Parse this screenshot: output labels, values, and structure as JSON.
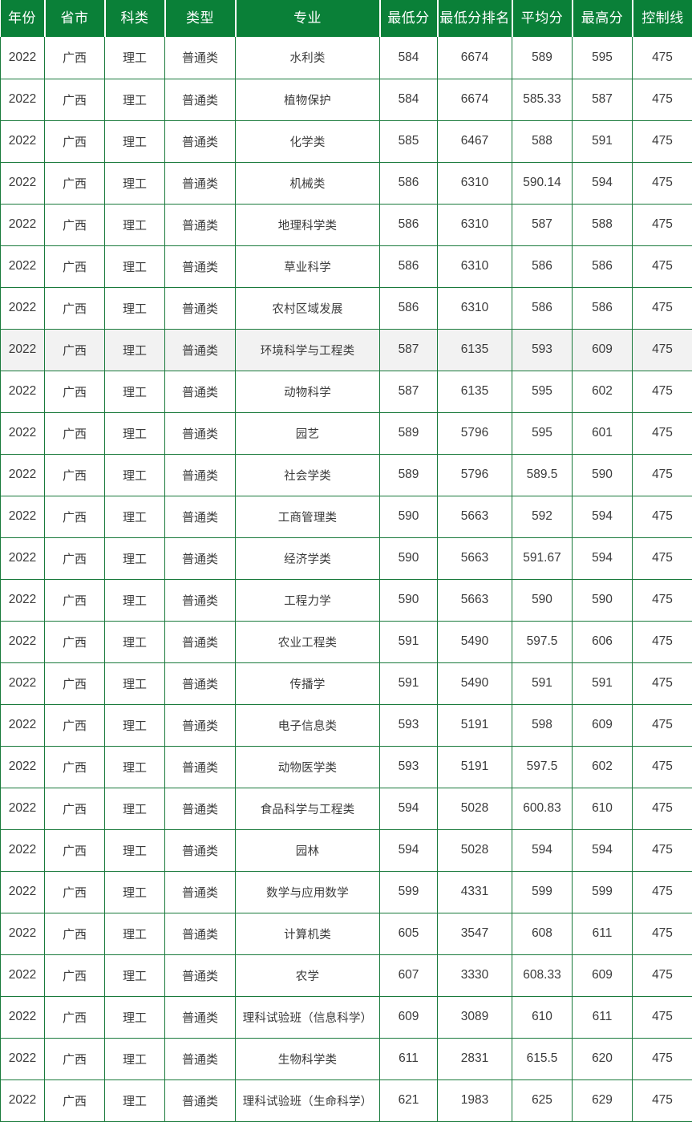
{
  "table": {
    "columns": [
      {
        "key": "year",
        "label": "年份"
      },
      {
        "key": "prov",
        "label": "省市"
      },
      {
        "key": "subj",
        "label": "科类"
      },
      {
        "key": "type",
        "label": "类型"
      },
      {
        "key": "major",
        "label": "专业"
      },
      {
        "key": "min",
        "label": "最低分"
      },
      {
        "key": "rank",
        "label": "最低分排名"
      },
      {
        "key": "avg",
        "label": "平均分"
      },
      {
        "key": "max",
        "label": "最高分"
      },
      {
        "key": "line",
        "label": "控制线"
      }
    ],
    "header_background": "#0a8038",
    "header_text_color": "#ffffff",
    "grid_color": "#1a7a3c",
    "highlight_background": "#f2f2f2",
    "highlighted_row_index": 7,
    "rows": [
      {
        "year": "2022",
        "prov": "广西",
        "subj": "理工",
        "type": "普通类",
        "major": "水利类",
        "min": "584",
        "rank": "6674",
        "avg": "589",
        "max": "595",
        "line": "475"
      },
      {
        "year": "2022",
        "prov": "广西",
        "subj": "理工",
        "type": "普通类",
        "major": "植物保护",
        "min": "584",
        "rank": "6674",
        "avg": "585.33",
        "max": "587",
        "line": "475"
      },
      {
        "year": "2022",
        "prov": "广西",
        "subj": "理工",
        "type": "普通类",
        "major": "化学类",
        "min": "585",
        "rank": "6467",
        "avg": "588",
        "max": "591",
        "line": "475"
      },
      {
        "year": "2022",
        "prov": "广西",
        "subj": "理工",
        "type": "普通类",
        "major": "机械类",
        "min": "586",
        "rank": "6310",
        "avg": "590.14",
        "max": "594",
        "line": "475"
      },
      {
        "year": "2022",
        "prov": "广西",
        "subj": "理工",
        "type": "普通类",
        "major": "地理科学类",
        "min": "586",
        "rank": "6310",
        "avg": "587",
        "max": "588",
        "line": "475"
      },
      {
        "year": "2022",
        "prov": "广西",
        "subj": "理工",
        "type": "普通类",
        "major": "草业科学",
        "min": "586",
        "rank": "6310",
        "avg": "586",
        "max": "586",
        "line": "475"
      },
      {
        "year": "2022",
        "prov": "广西",
        "subj": "理工",
        "type": "普通类",
        "major": "农村区域发展",
        "min": "586",
        "rank": "6310",
        "avg": "586",
        "max": "586",
        "line": "475"
      },
      {
        "year": "2022",
        "prov": "广西",
        "subj": "理工",
        "type": "普通类",
        "major": "环境科学与工程类",
        "min": "587",
        "rank": "6135",
        "avg": "593",
        "max": "609",
        "line": "475"
      },
      {
        "year": "2022",
        "prov": "广西",
        "subj": "理工",
        "type": "普通类",
        "major": "动物科学",
        "min": "587",
        "rank": "6135",
        "avg": "595",
        "max": "602",
        "line": "475"
      },
      {
        "year": "2022",
        "prov": "广西",
        "subj": "理工",
        "type": "普通类",
        "major": "园艺",
        "min": "589",
        "rank": "5796",
        "avg": "595",
        "max": "601",
        "line": "475"
      },
      {
        "year": "2022",
        "prov": "广西",
        "subj": "理工",
        "type": "普通类",
        "major": "社会学类",
        "min": "589",
        "rank": "5796",
        "avg": "589.5",
        "max": "590",
        "line": "475"
      },
      {
        "year": "2022",
        "prov": "广西",
        "subj": "理工",
        "type": "普通类",
        "major": "工商管理类",
        "min": "590",
        "rank": "5663",
        "avg": "592",
        "max": "594",
        "line": "475"
      },
      {
        "year": "2022",
        "prov": "广西",
        "subj": "理工",
        "type": "普通类",
        "major": "经济学类",
        "min": "590",
        "rank": "5663",
        "avg": "591.67",
        "max": "594",
        "line": "475"
      },
      {
        "year": "2022",
        "prov": "广西",
        "subj": "理工",
        "type": "普通类",
        "major": "工程力学",
        "min": "590",
        "rank": "5663",
        "avg": "590",
        "max": "590",
        "line": "475"
      },
      {
        "year": "2022",
        "prov": "广西",
        "subj": "理工",
        "type": "普通类",
        "major": "农业工程类",
        "min": "591",
        "rank": "5490",
        "avg": "597.5",
        "max": "606",
        "line": "475"
      },
      {
        "year": "2022",
        "prov": "广西",
        "subj": "理工",
        "type": "普通类",
        "major": "传播学",
        "min": "591",
        "rank": "5490",
        "avg": "591",
        "max": "591",
        "line": "475"
      },
      {
        "year": "2022",
        "prov": "广西",
        "subj": "理工",
        "type": "普通类",
        "major": "电子信息类",
        "min": "593",
        "rank": "5191",
        "avg": "598",
        "max": "609",
        "line": "475"
      },
      {
        "year": "2022",
        "prov": "广西",
        "subj": "理工",
        "type": "普通类",
        "major": "动物医学类",
        "min": "593",
        "rank": "5191",
        "avg": "597.5",
        "max": "602",
        "line": "475"
      },
      {
        "year": "2022",
        "prov": "广西",
        "subj": "理工",
        "type": "普通类",
        "major": "食品科学与工程类",
        "min": "594",
        "rank": "5028",
        "avg": "600.83",
        "max": "610",
        "line": "475"
      },
      {
        "year": "2022",
        "prov": "广西",
        "subj": "理工",
        "type": "普通类",
        "major": "园林",
        "min": "594",
        "rank": "5028",
        "avg": "594",
        "max": "594",
        "line": "475"
      },
      {
        "year": "2022",
        "prov": "广西",
        "subj": "理工",
        "type": "普通类",
        "major": "数学与应用数学",
        "min": "599",
        "rank": "4331",
        "avg": "599",
        "max": "599",
        "line": "475"
      },
      {
        "year": "2022",
        "prov": "广西",
        "subj": "理工",
        "type": "普通类",
        "major": "计算机类",
        "min": "605",
        "rank": "3547",
        "avg": "608",
        "max": "611",
        "line": "475"
      },
      {
        "year": "2022",
        "prov": "广西",
        "subj": "理工",
        "type": "普通类",
        "major": "农学",
        "min": "607",
        "rank": "3330",
        "avg": "608.33",
        "max": "609",
        "line": "475"
      },
      {
        "year": "2022",
        "prov": "广西",
        "subj": "理工",
        "type": "普通类",
        "major": "理科试验班（信息科学）",
        "min": "609",
        "rank": "3089",
        "avg": "610",
        "max": "611",
        "line": "475"
      },
      {
        "year": "2022",
        "prov": "广西",
        "subj": "理工",
        "type": "普通类",
        "major": "生物科学类",
        "min": "611",
        "rank": "2831",
        "avg": "615.5",
        "max": "620",
        "line": "475"
      },
      {
        "year": "2022",
        "prov": "广西",
        "subj": "理工",
        "type": "普通类",
        "major": "理科试验班（生命科学）",
        "min": "621",
        "rank": "1983",
        "avg": "625",
        "max": "629",
        "line": "475"
      }
    ]
  }
}
